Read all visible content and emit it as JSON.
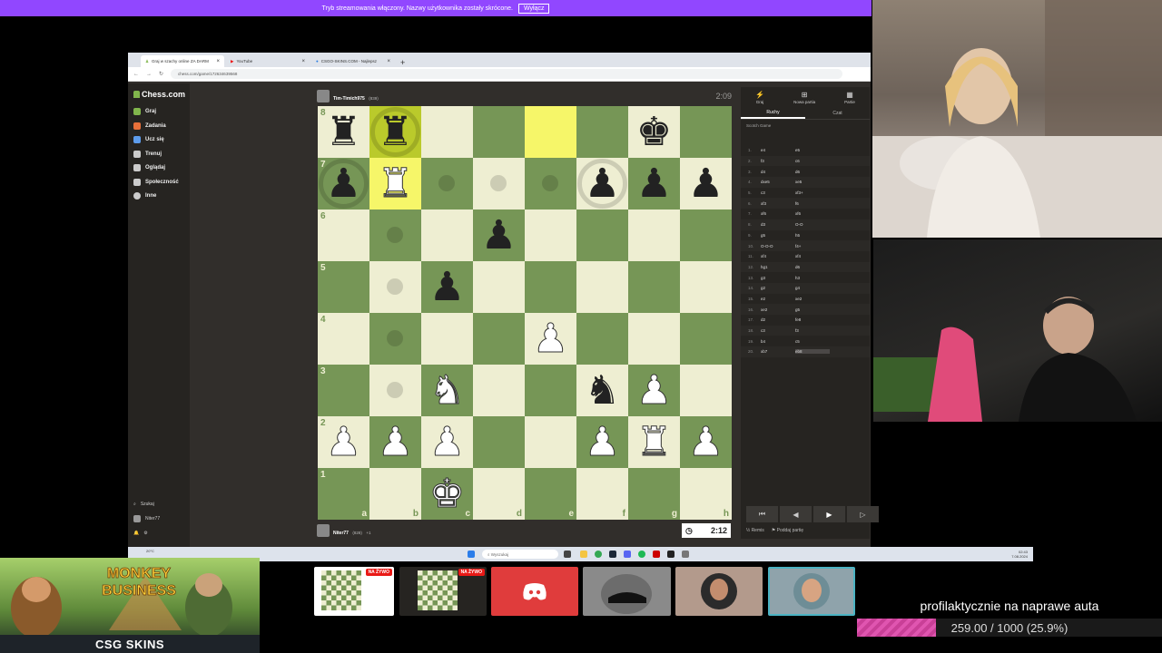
{
  "stream_notice": {
    "text": "Tryb streamowania włączony. Nazwy użytkownika zostały skrócone.",
    "button": "Wyłącz"
  },
  "browser": {
    "tabs": [
      {
        "label": "Graj w szachy online ZA DARM",
        "active": true
      },
      {
        "label": "YouTube",
        "active": false
      },
      {
        "label": "CSGO-SKINS.COM - Najlepsz",
        "active": false
      }
    ],
    "url": "chess.com/game/172634639568"
  },
  "sidebar": {
    "logo": "Chess.com",
    "items": [
      {
        "label": "Graj",
        "icon": "play-icon",
        "color": "#81b64c"
      },
      {
        "label": "Zadania",
        "icon": "puzzle-icon",
        "color": "#e8703a"
      },
      {
        "label": "Ucz się",
        "icon": "learn-icon",
        "color": "#5d9cec"
      },
      {
        "label": "Trenuj",
        "icon": "train-icon",
        "color": "#cccccc"
      },
      {
        "label": "Oglądaj",
        "icon": "watch-icon",
        "color": "#cccccc"
      },
      {
        "label": "Społeczność",
        "icon": "community-icon",
        "color": "#cccccc"
      },
      {
        "label": "Inne",
        "icon": "more-icon",
        "color": "#cccccc"
      }
    ],
    "search": "Szukaj",
    "user": "Niter77"
  },
  "players": {
    "top": {
      "name": "Tim-Timich975",
      "rating": "(839)",
      "clock": "2:09"
    },
    "bottom": {
      "name": "Niter77",
      "rating": "(828)",
      "clock": "2:12",
      "captured": "+1"
    }
  },
  "board": {
    "ranks": [
      "8",
      "7",
      "6",
      "5",
      "4",
      "3",
      "2",
      "1"
    ],
    "files": [
      "a",
      "b",
      "c",
      "d",
      "e",
      "f",
      "g",
      "h"
    ],
    "position": [
      [
        "bR",
        "bR",
        "",
        "",
        "",
        "",
        "bK",
        ""
      ],
      [
        "bP",
        "wR",
        "",
        "",
        "",
        "bP",
        "bP",
        "bP"
      ],
      [
        "",
        "",
        "",
        "bP",
        "",
        "",
        "",
        ""
      ],
      [
        "",
        "",
        "bP",
        "",
        "",
        "",
        "",
        ""
      ],
      [
        "",
        "",
        "",
        "",
        "wP",
        "",
        "",
        ""
      ],
      [
        "",
        "",
        "wN",
        "",
        "",
        "bN",
        "wP",
        ""
      ],
      [
        "wP",
        "wP",
        "wP",
        "",
        "",
        "wP",
        "wR",
        "wP"
      ],
      [
        "",
        "",
        "wK",
        "",
        "",
        "",
        "",
        ""
      ]
    ],
    "highlights": [
      "b8",
      "e8",
      "b7"
    ],
    "move_dots": [
      "c7",
      "d7",
      "e7",
      "b6",
      "b5",
      "b4",
      "b3"
    ],
    "capture_rings": [
      "b8",
      "a7",
      "f7"
    ]
  },
  "panel": {
    "tabs": [
      {
        "label": "Graj",
        "icon": "bolt-icon"
      },
      {
        "label": "Nowa partia",
        "icon": "plus-square-icon"
      },
      {
        "label": "Partie",
        "icon": "grid-icon"
      }
    ],
    "subtabs": [
      "Ruchy",
      "Czat"
    ],
    "opening": "Scotch Game",
    "moves": [
      [
        "1.",
        "e4",
        "e5"
      ],
      [
        "2.",
        "f3",
        "c6"
      ],
      [
        "3.",
        "d4",
        "d6"
      ],
      [
        "4.",
        "dxe5",
        "xe5"
      ],
      [
        "5.",
        "c3",
        "xf3+"
      ],
      [
        "6.",
        "xf3",
        "f6"
      ],
      [
        "7.",
        "xf6",
        "xf6"
      ],
      [
        "8.",
        "d3",
        "O-O"
      ],
      [
        "9.",
        "g5",
        "h5"
      ],
      [
        "10.",
        "O-O-O",
        "f4+"
      ],
      [
        "11.",
        "xf4",
        "xf4"
      ],
      [
        "12.",
        "hg1",
        "d6"
      ],
      [
        "13.",
        "g3",
        "h3"
      ],
      [
        "14.",
        "g2",
        "g4"
      ],
      [
        "15.",
        "e2",
        "xe2"
      ],
      [
        "16.",
        "xe2",
        "g5"
      ],
      [
        "17.",
        "d2",
        "fe8"
      ],
      [
        "18.",
        "c3",
        "f3"
      ],
      [
        "19.",
        "b4",
        "c5"
      ],
      [
        "20.",
        "xb7",
        "eb8"
      ]
    ],
    "controls": [
      "⏮",
      "◀",
      "▶",
      "▷",
      "⏭"
    ],
    "footer": {
      "draw": "Remis",
      "resign": "Poddaj partię"
    }
  },
  "taskbar": {
    "search": "Wyszukaj",
    "weather": "20°C",
    "time": "02:43",
    "date": "7.08.2024"
  },
  "ad": {
    "title": "MONKEY BUSINESS",
    "brand": "CSG SKINS"
  },
  "tiles": [
    {
      "type": "chess",
      "live": "NA ŻYWO"
    },
    {
      "type": "chess",
      "live": "NA ŻYWO"
    },
    {
      "type": "discord",
      "color": "#e03c3c"
    },
    {
      "type": "car",
      "color": "#8a8a8a"
    },
    {
      "type": "avatar",
      "color": "#b39a8c"
    },
    {
      "type": "avatar",
      "color": "#8fa3ab"
    }
  ],
  "goal": {
    "title": "profilaktycznie na naprawe auta",
    "progress_text": "259.00 / 1000 (25.9%)",
    "progress": 0.259
  }
}
